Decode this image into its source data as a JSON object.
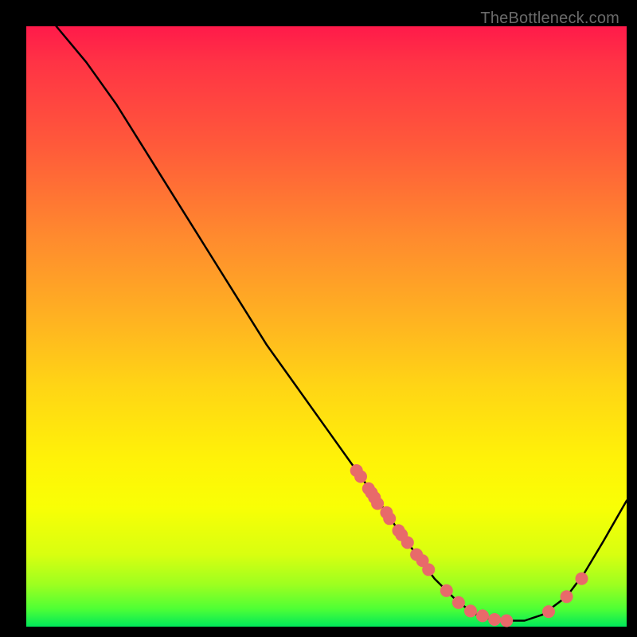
{
  "watermark": "TheBottleneck.com",
  "chart_data": {
    "type": "line",
    "title": "",
    "xlabel": "",
    "ylabel": "",
    "xlim": [
      0,
      100
    ],
    "ylim": [
      0,
      100
    ],
    "grid": false,
    "legend": false,
    "series": [
      {
        "name": "curve",
        "x": [
          5,
          10,
          15,
          20,
          25,
          30,
          35,
          40,
          45,
          50,
          55,
          60,
          62,
          65,
          68,
          70,
          72,
          75,
          78,
          80,
          83,
          86,
          90,
          93,
          96,
          100
        ],
        "y": [
          100,
          94,
          87,
          79,
          71,
          63,
          55,
          47,
          40,
          33,
          26,
          19,
          16,
          12,
          8,
          6,
          4,
          2,
          1,
          1,
          1,
          2,
          5,
          9,
          14,
          21
        ]
      }
    ],
    "scatter_points": {
      "name": "dots",
      "x": [
        55,
        55.7,
        57,
        57.5,
        58,
        58.5,
        60,
        60.5,
        62,
        62.5,
        63.5,
        65,
        66,
        67,
        70,
        72,
        74,
        76,
        78,
        80,
        87,
        90,
        92.5
      ],
      "y": [
        26,
        25,
        23,
        22.3,
        21.5,
        20.5,
        19,
        18,
        16,
        15.3,
        14,
        12,
        11,
        9.5,
        6,
        4,
        2.6,
        1.8,
        1.2,
        1,
        2.5,
        5,
        8
      ]
    },
    "colors": {
      "curve": "#000000",
      "dots": "#e86a6a"
    }
  }
}
